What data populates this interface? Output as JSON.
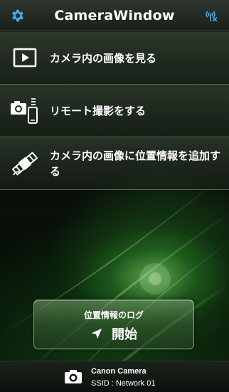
{
  "header": {
    "title": "CameraWindow",
    "settings_icon": "gear-icon",
    "connection_icon": "wifi-disconnect-icon",
    "accent_color": "#3fa9f5"
  },
  "menu": {
    "items": [
      {
        "label": "カメラ内の画像を見る",
        "icon": "play-icon"
      },
      {
        "label": "リモート撮影をする",
        "icon": "camera-phone-icon"
      },
      {
        "label": "カメラ内の画像に位置情報を追加する",
        "icon": "satellite-icon"
      }
    ]
  },
  "gps_log": {
    "caption": "位置情報のログ",
    "action_label": "開始",
    "icon": "location-arrow-icon"
  },
  "footer": {
    "camera_name": "Canon Camera",
    "ssid": "SSID : Network 01",
    "icon": "camera-icon"
  }
}
